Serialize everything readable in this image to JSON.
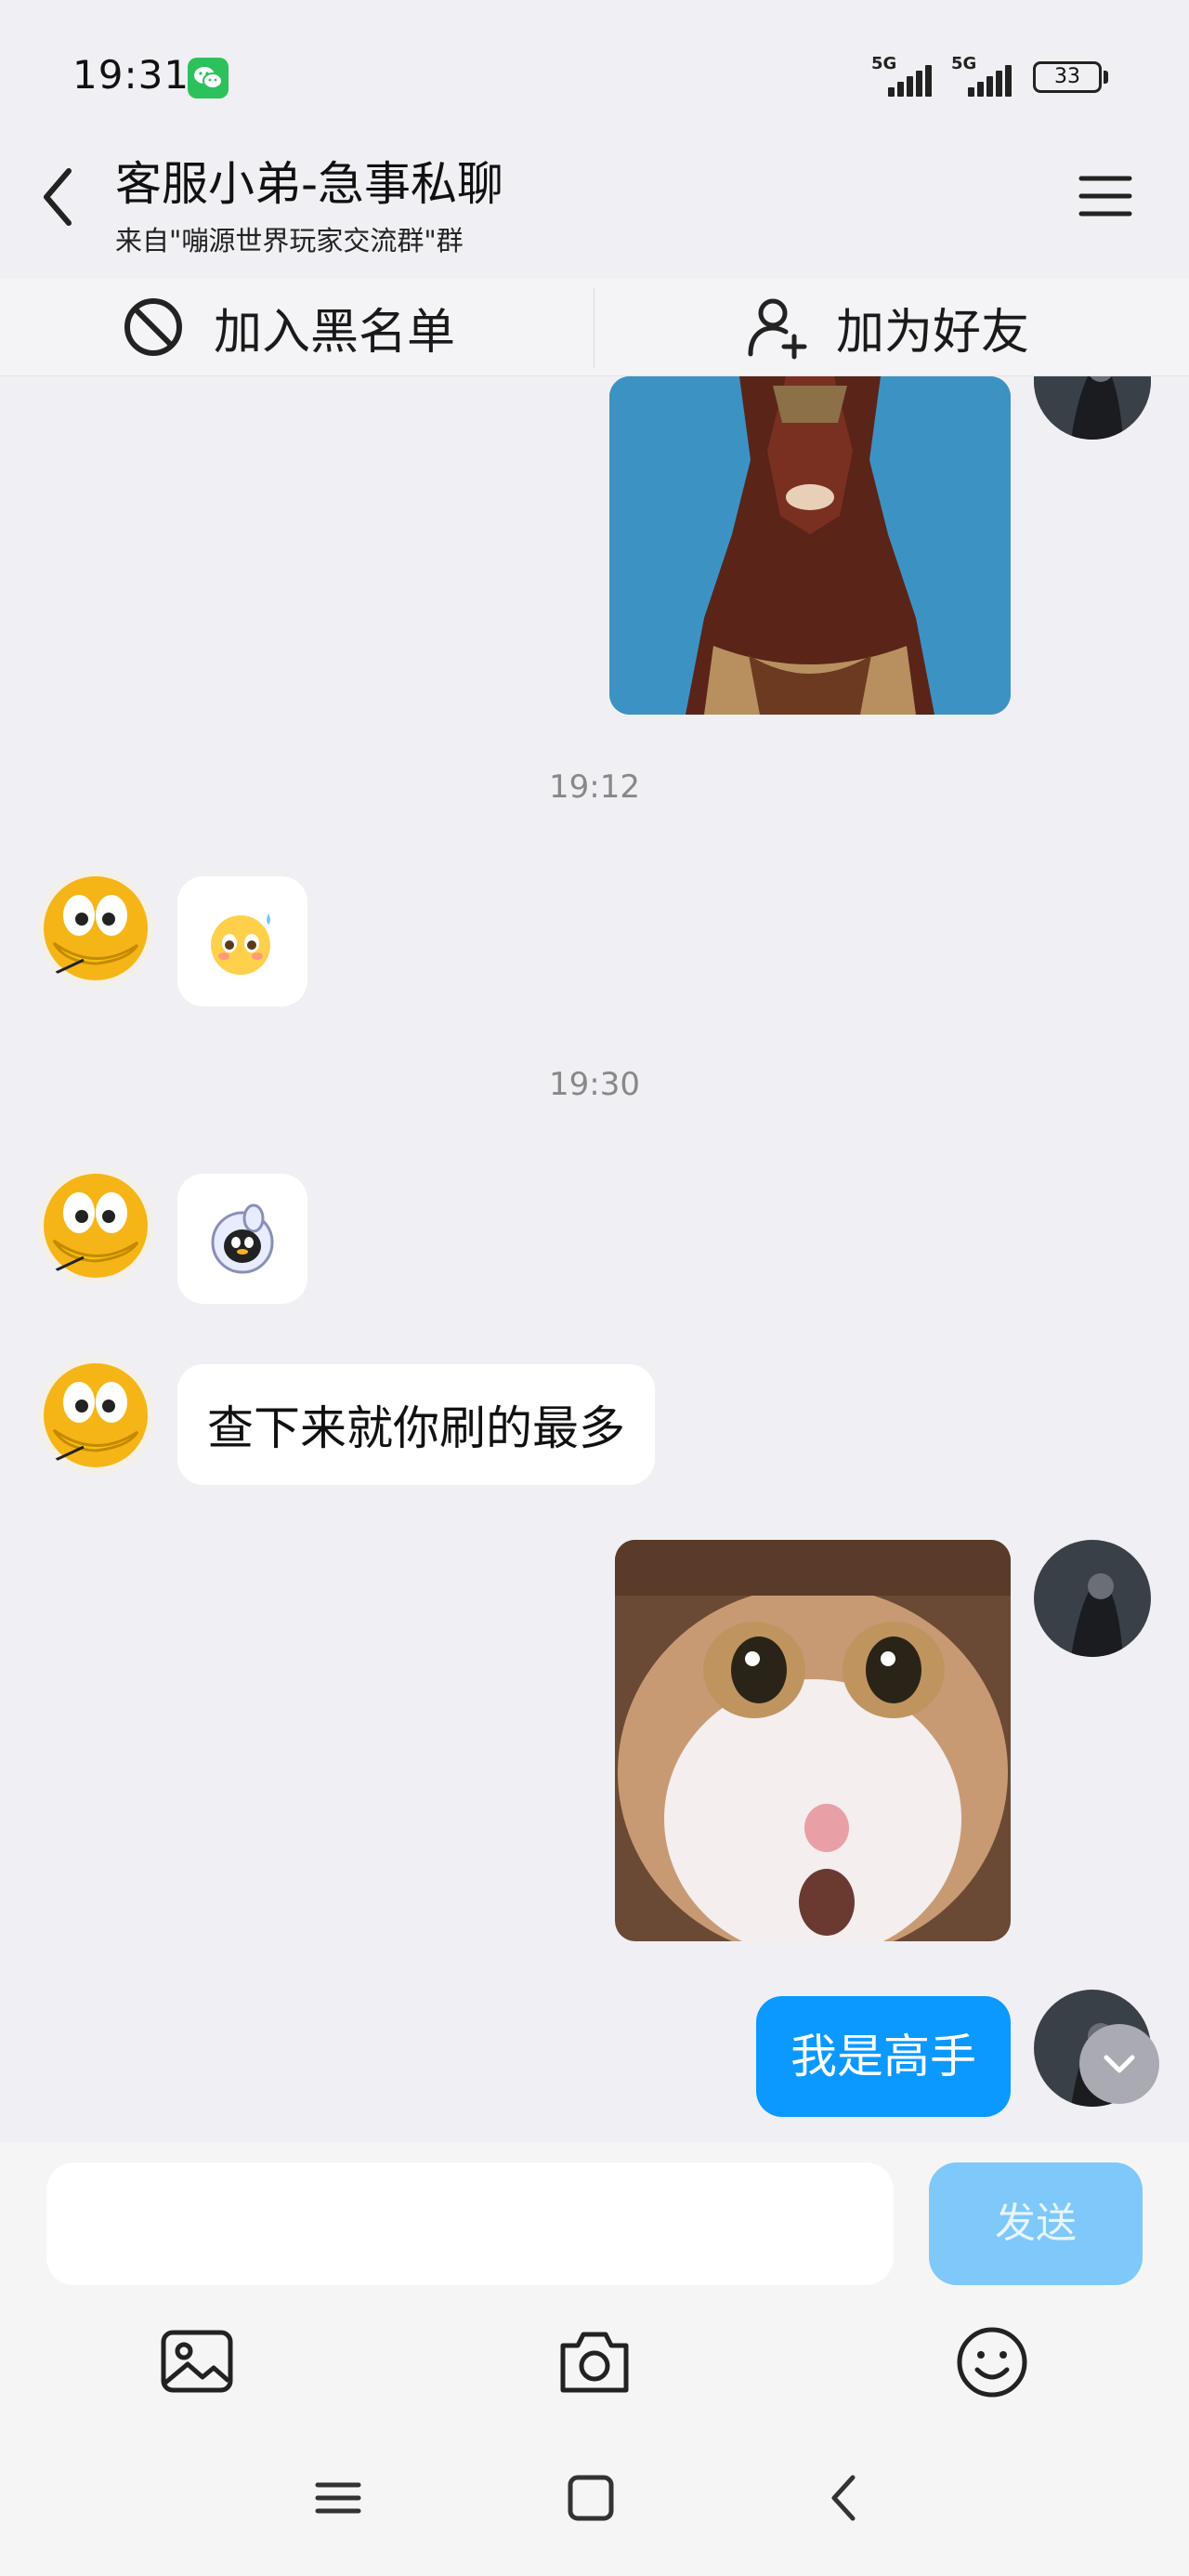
{
  "status_bar": {
    "time": "19:31",
    "signal_1_label": "5G",
    "signal_2_label": "5G",
    "battery": "33"
  },
  "header": {
    "title": "客服小弟-急事私聊",
    "subtitle": "来自\"嘣源世界玩家交流群\"群"
  },
  "actions": {
    "blacklist_label": "加入黑名单",
    "add_friend_label": "加为好友"
  },
  "messages": {
    "timestamp_1": "19:12",
    "timestamp_2": "19:30",
    "text_in": "查下来就你刷的最多",
    "text_out": "我是高手"
  },
  "input": {
    "placeholder": "",
    "send_label": "发送"
  },
  "colors": {
    "accent": "#0b99ff",
    "send_disabled": "#7ec8fa",
    "background": "#f0f0f4"
  },
  "icons": [
    "wechat-icon",
    "back-icon",
    "menu-icon",
    "block-icon",
    "add-user-icon",
    "image-icon",
    "camera-icon",
    "emoji-icon",
    "chevron-down-icon"
  ]
}
